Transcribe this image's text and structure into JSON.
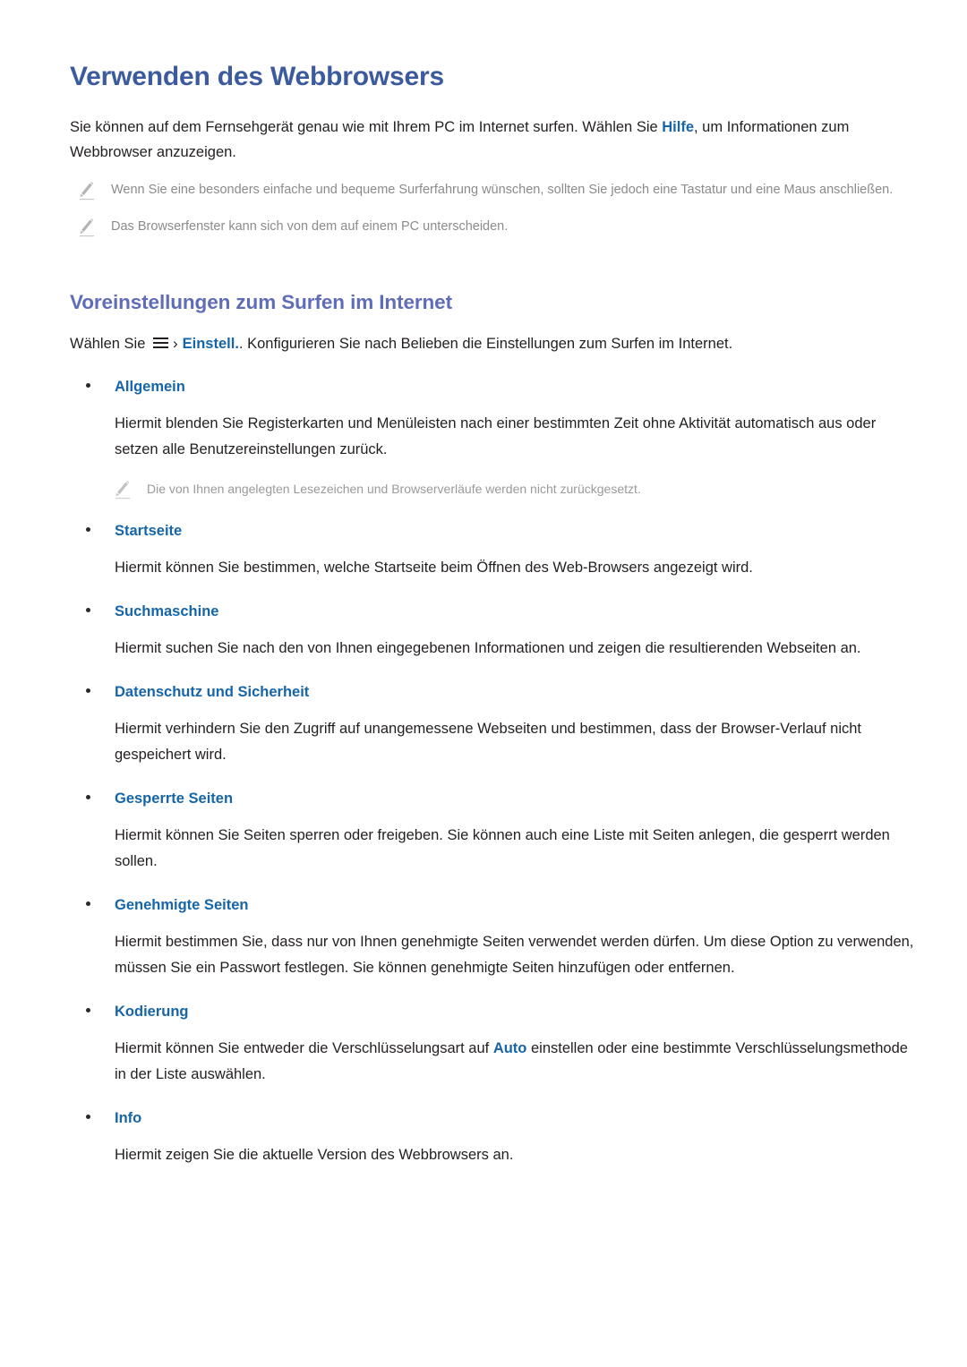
{
  "document": {
    "title": "Verwenden des Webbrowsers",
    "intro": {
      "before": "Sie können auf dem Fernsehgerät genau wie mit Ihrem PC im Internet surfen. Wählen Sie ",
      "accent": "Hilfe",
      "after": ", um Informationen zum Webbrowser anzuzeigen."
    },
    "notes": [
      {
        "icon": "pencil-icon",
        "text": "Wenn Sie eine besonders einfache und bequeme Surferfahrung wünschen, sollten Sie jedoch eine Tastatur und eine Maus anschließen."
      },
      {
        "icon": "pencil-icon",
        "text": "Das Browserfenster kann sich von dem auf einem PC unterscheiden."
      }
    ],
    "section_heading": "Voreinstellungen zum Surfen im Internet",
    "lead": {
      "before": "Wählen Sie ",
      "menu_icon": "hamburger-menu-icon",
      "chevron": "›",
      "accent": "Einstell.",
      "after": ". Konfigurieren Sie nach Belieben die Einstellungen zum Surfen im Internet."
    },
    "settings": [
      {
        "label": "Allgemein",
        "body": "Hiermit blenden Sie Registerkarten und Menüleisten nach einer bestimmten Zeit ohne Aktivität automatisch aus oder setzen alle Benutzereinstellungen zurück.",
        "note": {
          "icon": "pencil-icon",
          "text": "Die von Ihnen angelegten Lesezeichen und Browserverläufe werden nicht zurückgesetzt."
        }
      },
      {
        "label": "Startseite",
        "body": "Hiermit können Sie bestimmen, welche Startseite beim Öffnen des Web-Browsers angezeigt wird."
      },
      {
        "label": "Suchmaschine",
        "body": "Hiermit suchen Sie nach den von Ihnen eingegebenen Informationen und zeigen die resultierenden Webseiten an."
      },
      {
        "label": "Datenschutz und Sicherheit",
        "body": "Hiermit verhindern Sie den Zugriff auf unangemessene Webseiten und bestimmen, dass der Browser-Verlauf nicht gespeichert wird."
      },
      {
        "label": "Gesperrte Seiten",
        "body": "Hiermit können Sie Seiten sperren oder freigeben. Sie können auch eine Liste mit Seiten anlegen, die gesperrt werden sollen."
      },
      {
        "label": "Genehmigte Seiten",
        "body": "Hiermit bestimmen Sie, dass nur von Ihnen genehmigte Seiten verwendet werden dürfen. Um diese Option zu verwenden, müssen Sie ein Passwort festlegen. Sie können genehmigte Seiten hinzufügen oder entfernen."
      },
      {
        "label": "Kodierung",
        "body_before": "Hiermit können Sie entweder die Verschlüsselungsart auf ",
        "body_accent": "Auto",
        "body_after": " einstellen oder eine bestimmte Verschlüsselungsmethode in der Liste auswählen."
      },
      {
        "label": "Info",
        "body": "Hiermit zeigen Sie die aktuelle Version des Webbrowsers an."
      }
    ]
  },
  "colors": {
    "title": "#3c5a9e",
    "subheading": "#5f6cb8",
    "accent": "#1565a8",
    "body": "#231f20",
    "note": "#8b8b8b",
    "background": "#ffffff"
  }
}
